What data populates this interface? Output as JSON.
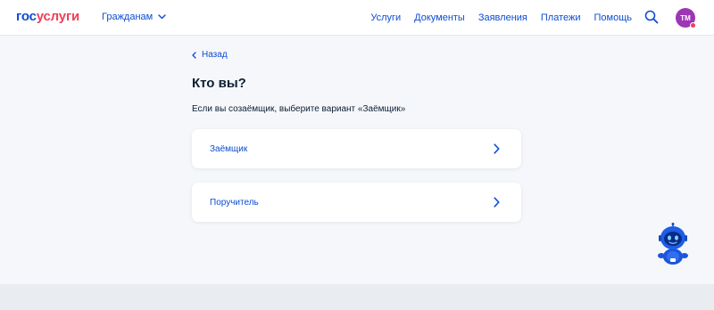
{
  "header": {
    "logo_part1": "гос",
    "logo_part2": "услуги",
    "audience": "Гражданам",
    "nav": [
      "Услуги",
      "Документы",
      "Заявления",
      "Платежи",
      "Помощь"
    ],
    "avatar_initials": "ТМ"
  },
  "main": {
    "back_label": "Назад",
    "title": "Кто вы?",
    "subtitle": "Если вы созаёмщик, выберите вариант «Заёмщик»",
    "options": [
      {
        "label": "Заёмщик"
      },
      {
        "label": "Поручитель"
      }
    ]
  },
  "colors": {
    "accent": "#0d4cd3",
    "brand_red": "#ee3f58",
    "avatar": "#9c36b5",
    "background": "#f5f7fa"
  },
  "icons": [
    "chevron-down-icon",
    "search-icon",
    "chevron-left-icon",
    "chevron-right-icon",
    "assistant-robot-icon"
  ]
}
